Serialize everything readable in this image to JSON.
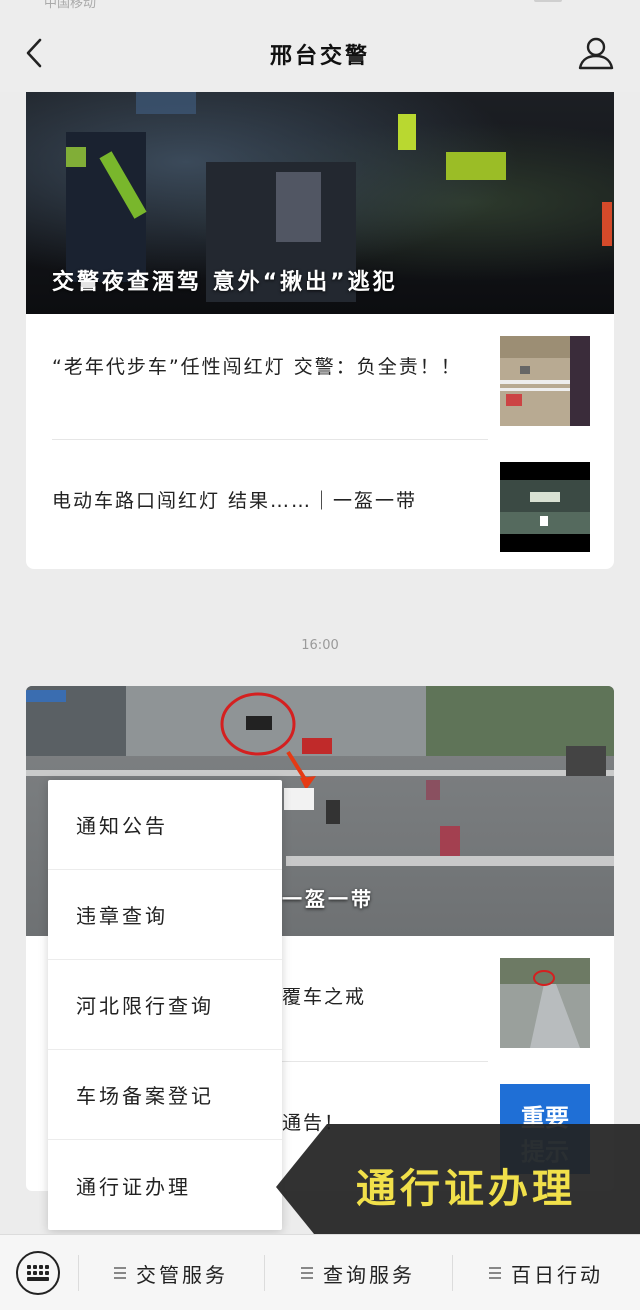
{
  "status_bar": {
    "carrier": "中国移动"
  },
  "header": {
    "title": "邢台交警"
  },
  "articles_group1": {
    "hero_title": "交警夜查酒驾  意外“揪出”逃犯",
    "items": [
      {
        "title": "“老年代步车”任性闯红灯 交警：负全责！！"
      },
      {
        "title": "电动车路口闯红灯 结果……｜一盔一带"
      }
    ]
  },
  "timestamp": "16:00",
  "articles_group2": {
    "hero_title": "一盔一带",
    "items": [
      {
        "title": "覆车之戒"
      },
      {
        "title": "通告！"
      }
    ],
    "thumb_badge": {
      "line1": "重要",
      "line2": "提示"
    }
  },
  "popup_menu": {
    "items": [
      "通知公告",
      "违章查询",
      "河北限行查询",
      "车场备案登记",
      "通行证办理"
    ]
  },
  "caption_overlay": {
    "text": "通行证办理"
  },
  "bottom_bar": {
    "menus": [
      "交管服务",
      "查询服务",
      "百日行动"
    ]
  },
  "colors": {
    "background": "#ececec",
    "card": "#ffffff",
    "caption_text": "#f1e04a",
    "caption_bg": "#222222",
    "badge_blue": "#1f6fd6"
  }
}
